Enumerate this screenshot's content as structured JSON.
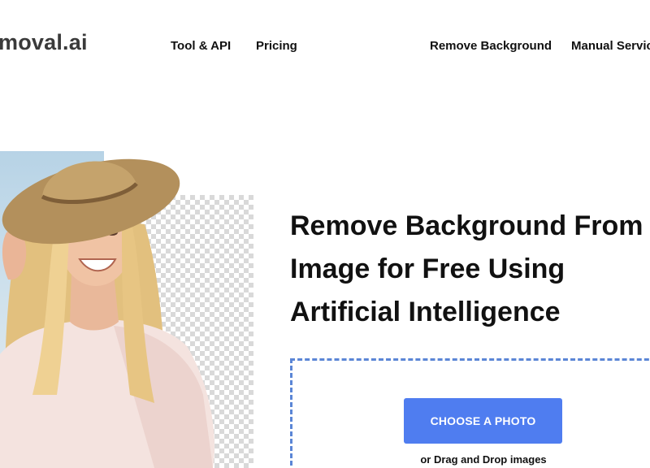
{
  "header": {
    "logo": {
      "main": "moval",
      "suffix": ".ai"
    },
    "nav": {
      "tool_api": "Tool & API",
      "pricing": "Pricing",
      "remove_background": "Remove Background",
      "manual_service": "Manual Service"
    }
  },
  "hero": {
    "headline_lines": [
      "Remove Background From",
      "Image for Free Using",
      "Artificial Intelligence"
    ],
    "upload": {
      "button_label": "CHOOSE A PHOTO",
      "drag_drop_text": "or Drag and Drop images"
    }
  },
  "colors": {
    "accent_button": "#4f7df0",
    "dashed_border": "#5b86d6",
    "text": "#111111"
  }
}
